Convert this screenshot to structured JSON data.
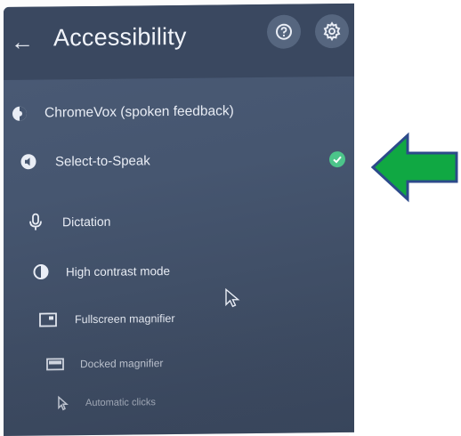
{
  "header": {
    "title": "Accessibility",
    "back_icon": "arrow-left-icon",
    "help_icon": "help-icon",
    "settings_icon": "gear-icon"
  },
  "items": [
    {
      "label": "ChromeVox (spoken feedback)",
      "icon": "chromevox-icon",
      "checked": false
    },
    {
      "label": "Select-to-Speak",
      "icon": "select-to-speak-icon",
      "checked": true
    },
    {
      "label": "Dictation",
      "icon": "microphone-icon",
      "checked": false
    },
    {
      "label": "High contrast mode",
      "icon": "contrast-icon",
      "checked": false
    },
    {
      "label": "Fullscreen magnifier",
      "icon": "fullscreen-magnifier-icon",
      "checked": false
    },
    {
      "label": "Docked magnifier",
      "icon": "docked-magnifier-icon",
      "checked": false
    },
    {
      "label": "Automatic clicks",
      "icon": "automatic-clicks-icon",
      "checked": false
    }
  ],
  "colors": {
    "panel": "#465670",
    "check": "#4cc48a",
    "arrow": "#10a843",
    "arrow_outline": "#2c4a8a"
  }
}
